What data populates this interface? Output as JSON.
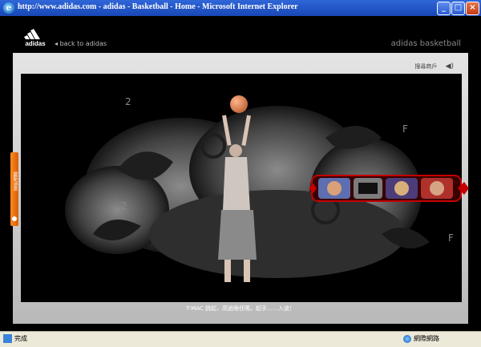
{
  "window": {
    "title": "http://www.adidas.com - adidas - Basketball - Home - Microsoft Internet Explorer",
    "buttons": [
      "_",
      "□",
      "×"
    ]
  },
  "header": {
    "logo": "adidas",
    "back_link": "back to adidas",
    "brand": "adidas basketball"
  },
  "toolbar": {
    "store_link": "搜尋商戶"
  },
  "stage": {
    "numbers": [
      "2",
      "F",
      "2",
      "F"
    ],
    "side_tab_label": "最新消息",
    "caption": "T-MAC 跳起，高過眼任嗎，起手……入波！"
  },
  "statusbar": {
    "status": "完成",
    "zone": "網際網路"
  },
  "colors": {
    "accent": "#ff8a1f",
    "titlebar": "#2f66d8"
  },
  "icons": [
    "ie-icon",
    "adidas-logo-icon",
    "back-arrow-icon",
    "speaker-icon",
    "globe-icon"
  ]
}
